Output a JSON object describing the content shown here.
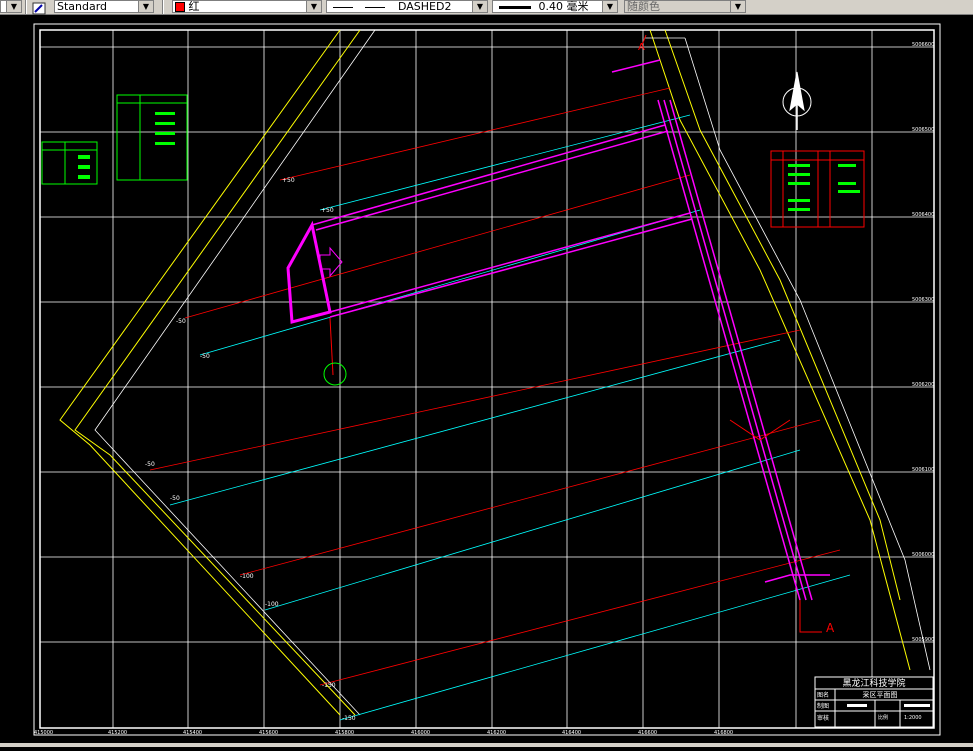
{
  "toolbar": {
    "text_style": "Standard",
    "color_label": "红",
    "color_swatch": "#ff0000",
    "linetype": "DASHED2",
    "lineweight": "0.40 毫米",
    "plot_style": "随颜色"
  },
  "drawing": {
    "title_block": {
      "org": "黑龙江科技学院",
      "name_label": "图名",
      "drawing_name": "采区平面图",
      "drawn_label": "制图",
      "check_label": "审核",
      "scale_label": "比例",
      "scale": "1:2000"
    },
    "section_mark": "A",
    "x_coords": [
      "415000",
      "415200",
      "415400",
      "415600",
      "415800",
      "416000",
      "416200",
      "416400",
      "416600",
      "416800"
    ],
    "y_coords": [
      "5006600",
      "5006500",
      "5006400",
      "5006300",
      "5006200",
      "5006100",
      "5006000",
      "5005900",
      "5005800",
      "5005700"
    ],
    "contours": [
      "+50",
      "+50",
      "-50",
      "-50",
      "-50",
      "-50",
      "-100",
      "-100",
      "-150",
      "-150"
    ],
    "colors": {
      "grid": "#ffffff",
      "contour_red": "#ff0000",
      "contour_cyan": "#00ffff",
      "boundary": "#ffff00",
      "roadway": "#ff00ff",
      "legend": "#00ff00"
    }
  }
}
